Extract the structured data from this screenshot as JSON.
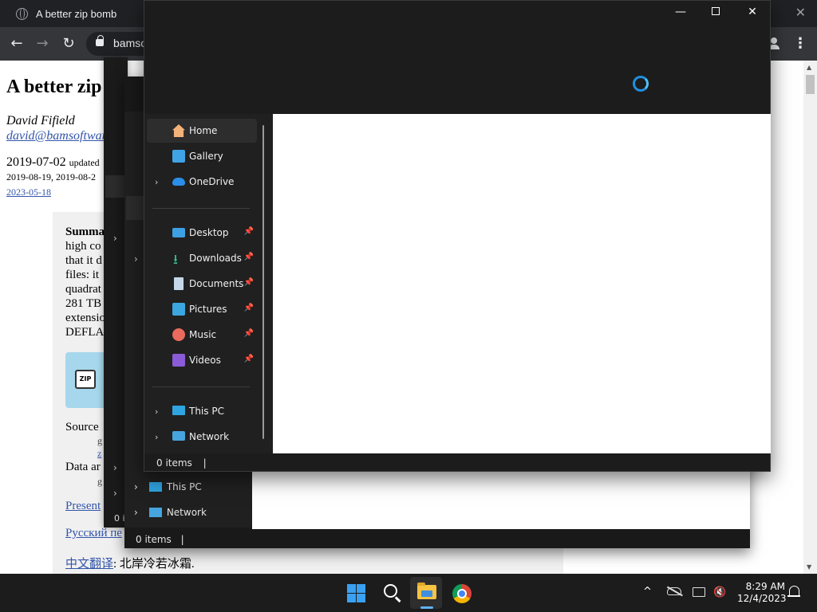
{
  "browser": {
    "tab_title": "A better zip bomb",
    "close_glyph": "✕",
    "url": "bamso",
    "nav": {
      "back": "←",
      "forward": "→",
      "reload": "↻"
    },
    "menu_glyph": "⋮"
  },
  "article": {
    "title": "A better zip",
    "author": "David Fifield",
    "email": "david@bamsoftwar",
    "date_line": "2019-07-02",
    "updated_word": "updated",
    "dates_line2": "2019-08-19, 2019-08-2",
    "date_link": "2023-05-18",
    "summary_lines": [
      "Summa",
      "high co",
      "that it d",
      "files: it",
      "quadrat",
      "281 TB",
      "extensio",
      "DEFLA"
    ],
    "zip_label": "ZIP",
    "source_label": "Source",
    "source_sub": "g",
    "source_link": "z",
    "data_label": "Data ar",
    "data_sub": "g",
    "present_link": "Present",
    "russian_link": "Русский пе",
    "chinese_link": "中文翻译",
    "chinese_text": ": 北岸冷若冰霜."
  },
  "explorer_front": {
    "title_buttons": {
      "minimize": "—",
      "close": "✕"
    },
    "nav_items": [
      {
        "label": "Home",
        "icon": "home-icon",
        "chevron": false,
        "pinned": false,
        "active": true
      },
      {
        "label": "Gallery",
        "icon": "gallery-icon",
        "chevron": false,
        "pinned": false,
        "active": false
      },
      {
        "label": "OneDrive",
        "icon": "onedrive-icon",
        "chevron": true,
        "pinned": false,
        "active": false
      },
      {
        "label": "Desktop",
        "icon": "desktop-icon",
        "chevron": false,
        "pinned": true,
        "active": false
      },
      {
        "label": "Downloads",
        "icon": "downloads-icon",
        "chevron": false,
        "pinned": true,
        "active": false
      },
      {
        "label": "Documents",
        "icon": "documents-icon",
        "chevron": false,
        "pinned": true,
        "active": false
      },
      {
        "label": "Pictures",
        "icon": "pictures-icon",
        "chevron": false,
        "pinned": true,
        "active": false
      },
      {
        "label": "Music",
        "icon": "music-icon",
        "chevron": false,
        "pinned": true,
        "active": false
      },
      {
        "label": "Videos",
        "icon": "videos-icon",
        "chevron": false,
        "pinned": true,
        "active": false
      },
      {
        "label": "This PC",
        "icon": "this-pc-icon",
        "chevron": true,
        "pinned": false,
        "active": false
      },
      {
        "label": "Network",
        "icon": "network-icon",
        "chevron": true,
        "pinned": false,
        "active": false
      }
    ],
    "chevron_glyph": "›",
    "pin_glyph": "📌",
    "status": "0 items",
    "status_caret": "|"
  },
  "explorer_back1": {
    "items": [
      {
        "label": "This PC",
        "icon": "this-pc-icon"
      },
      {
        "label": "Network",
        "icon": "network-icon"
      }
    ],
    "status": "0 items",
    "status_caret": "|"
  },
  "explorer_back2": {
    "status_fragment": "0 i"
  },
  "taskbar": {
    "time": "8:29 AM",
    "date": "12/4/2023",
    "tray_chevron": "^",
    "volume_glyph": "🔇",
    "accent": "#3aa0f2"
  }
}
